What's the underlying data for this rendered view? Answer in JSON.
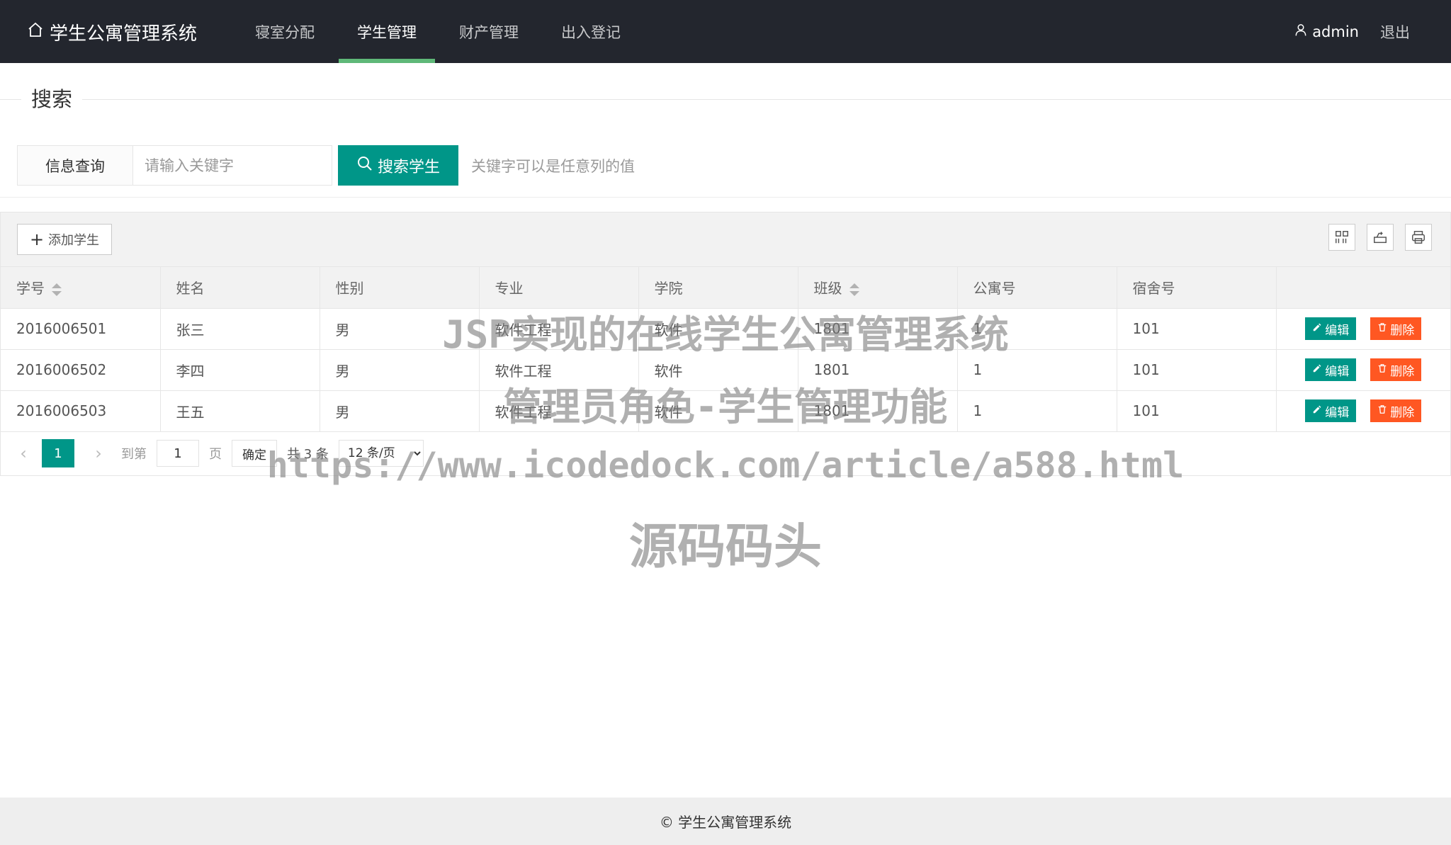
{
  "header": {
    "logo_text": "学生公寓管理系统",
    "nav": [
      {
        "label": "寝室分配",
        "active": false
      },
      {
        "label": "学生管理",
        "active": true
      },
      {
        "label": "财产管理",
        "active": false
      },
      {
        "label": "出入登记",
        "active": false
      }
    ],
    "user_name": "admin",
    "logout_label": "退出"
  },
  "search": {
    "legend": "搜索",
    "label": "信息查询",
    "input_value": "",
    "placeholder": "请输入关键字",
    "button_label": "搜索学生",
    "hint": "关键字可以是任意列的值"
  },
  "toolbar": {
    "add_label": "添加学生",
    "icons": [
      "columns-icon",
      "export-icon",
      "print-icon"
    ]
  },
  "table": {
    "columns": [
      "学号",
      "姓名",
      "性别",
      "专业",
      "学院",
      "班级",
      "公寓号",
      "宿舍号",
      ""
    ],
    "sortable": [
      true,
      false,
      false,
      false,
      false,
      true,
      false,
      false,
      false
    ],
    "rows": [
      [
        "2016006501",
        "张三",
        "男",
        "软件工程",
        "软件",
        "1801",
        "1",
        "101"
      ],
      [
        "2016006502",
        "李四",
        "男",
        "软件工程",
        "软件",
        "1801",
        "1",
        "101"
      ],
      [
        "2016006503",
        "王五",
        "男",
        "软件工程",
        "软件",
        "1801",
        "1",
        "101"
      ]
    ],
    "edit_label": "编辑",
    "delete_label": "删除"
  },
  "pager": {
    "current_page": "1",
    "goto_prefix": "到第",
    "goto_value": "1",
    "goto_suffix": "页",
    "ok_label": "确定",
    "total_text": "共 3 条",
    "page_size": "12 条/页"
  },
  "watermark": {
    "line1": "JSP实现的在线学生公寓管理系统",
    "line2": "管理员角色-学生管理功能",
    "line3": "https://www.icodedock.com/article/a588.html",
    "line4": "源码码头"
  },
  "footer": {
    "text": "© 学生公寓管理系统"
  },
  "colors": {
    "header_bg": "#23262e",
    "accent": "#009688",
    "nav_underline": "#5fb878",
    "danger": "#ff5722"
  }
}
